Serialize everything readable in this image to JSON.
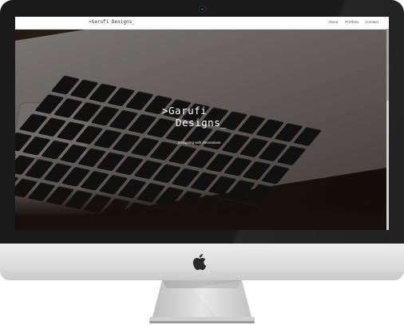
{
  "site": {
    "logo": ">Garufi Designs_",
    "nav": [
      {
        "label": "About"
      },
      {
        "label": "Portfolio"
      },
      {
        "label": "Contact"
      }
    ]
  },
  "hero": {
    "title_line1": ">Garufi",
    "title_line2": "Designs_",
    "tagline": "Designing with innovations"
  },
  "icons": {
    "camera": "webcam-icon",
    "brand": "apple-logo-icon"
  },
  "colors": {
    "bezel": "#1a1a1b",
    "chin": "#e0e0e0",
    "header_bg": "#ffffff",
    "hero_text": "#ffffff"
  }
}
